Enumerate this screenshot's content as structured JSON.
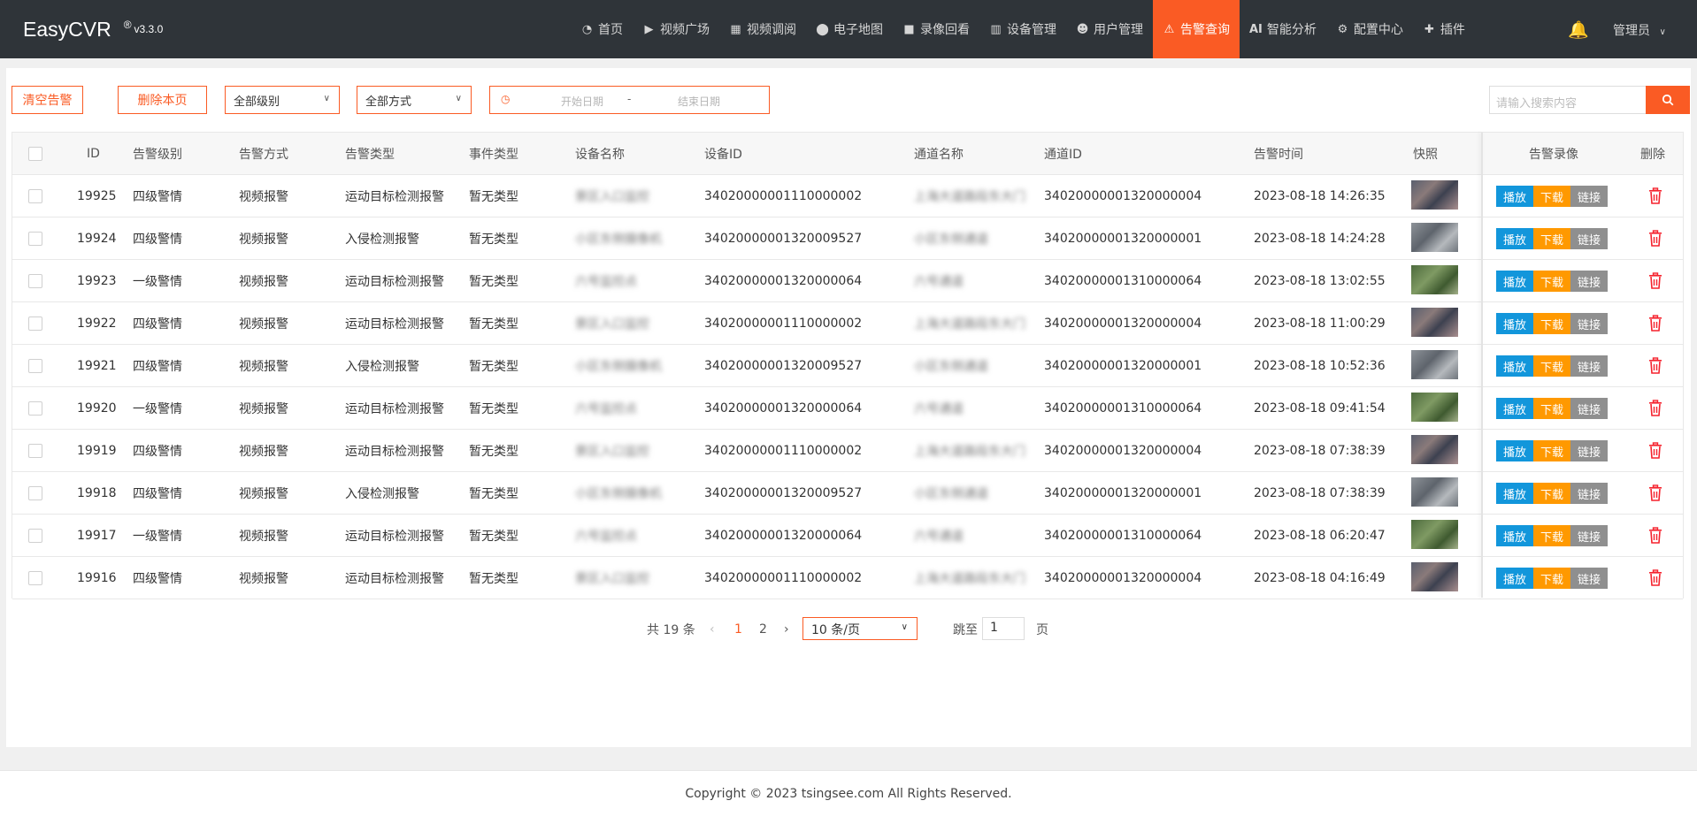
{
  "app": {
    "name": "EasyCVR",
    "registered": "®",
    "version": "v3.3.0"
  },
  "nav": [
    {
      "label": "首页",
      "icon": "dashboard-icon",
      "glyph": "◔",
      "active": false
    },
    {
      "label": "视频广场",
      "icon": "play-circle-icon",
      "glyph": "▶",
      "active": false
    },
    {
      "label": "视频调阅",
      "icon": "grid-layout-icon",
      "glyph": "▦",
      "active": false
    },
    {
      "label": "电子地图",
      "icon": "map-pin-icon",
      "glyph": "⬤",
      "active": false
    },
    {
      "label": "录像回看",
      "icon": "video-camera-icon",
      "glyph": "■",
      "active": false
    },
    {
      "label": "设备管理",
      "icon": "device-icon",
      "glyph": "▥",
      "active": false
    },
    {
      "label": "用户管理",
      "icon": "user-icon",
      "glyph": "☻",
      "active": false
    },
    {
      "label": "告警查询",
      "icon": "alarm-siren-icon",
      "glyph": "⚠",
      "active": true
    },
    {
      "label": "智能分析",
      "icon": "ai-icon",
      "glyph": "AI",
      "active": false
    },
    {
      "label": "配置中心",
      "icon": "gear-icon",
      "glyph": "⚙",
      "active": false
    },
    {
      "label": "插件",
      "icon": "puzzle-icon",
      "glyph": "✚",
      "active": false
    }
  ],
  "user": {
    "label": "管理员"
  },
  "toolbar": {
    "clear_label": "清空告警",
    "delete_page_label": "删除本页",
    "level_select": "全部级别",
    "method_select": "全部方式",
    "date_start_placeholder": "开始日期",
    "date_sep": "-",
    "date_end_placeholder": "结束日期",
    "search_placeholder": "请输入搜索内容"
  },
  "table": {
    "headers": {
      "id": "ID",
      "level": "告警级别",
      "method": "告警方式",
      "type": "告警类型",
      "event": "事件类型",
      "device_name": "设备名称",
      "device_id": "设备ID",
      "channel_name": "通道名称",
      "channel_id": "通道ID",
      "time": "告警时间",
      "snapshot": "快照",
      "recording": "告警录像",
      "delete": "删除"
    },
    "action_labels": {
      "play": "播放",
      "download": "下载",
      "link": "链接"
    },
    "rows": [
      {
        "id": "19925",
        "level": "四级警情",
        "method": "视频报警",
        "type": "运动目标检测报警",
        "event": "暂无类型",
        "device_name": "景区入口监控",
        "device_id": "34020000001110000002",
        "channel_name": "上海大道路段东大门",
        "channel_id": "34020000001320000004",
        "time": "2023-08-18 14:26:35",
        "snap": "dark"
      },
      {
        "id": "19924",
        "level": "四级警情",
        "method": "视频报警",
        "type": "入侵检测报警",
        "event": "暂无类型",
        "device_name": "小区东侧摄像机",
        "device_id": "34020000001320009527",
        "channel_name": "小区东侧通道",
        "channel_id": "34020000001320000001",
        "time": "2023-08-18 14:24:28",
        "snap": "gray"
      },
      {
        "id": "19923",
        "level": "一级警情",
        "method": "视频报警",
        "type": "运动目标检测报警",
        "event": "暂无类型",
        "device_name": "六号监控点",
        "device_id": "34020000001320000064",
        "channel_name": "六号通道",
        "channel_id": "34020000001310000064",
        "time": "2023-08-18 13:02:55",
        "snap": "green"
      },
      {
        "id": "19922",
        "level": "四级警情",
        "method": "视频报警",
        "type": "运动目标检测报警",
        "event": "暂无类型",
        "device_name": "景区入口监控",
        "device_id": "34020000001110000002",
        "channel_name": "上海大道路段东大门",
        "channel_id": "34020000001320000004",
        "time": "2023-08-18 11:00:29",
        "snap": "dark"
      },
      {
        "id": "19921",
        "level": "四级警情",
        "method": "视频报警",
        "type": "入侵检测报警",
        "event": "暂无类型",
        "device_name": "小区东侧摄像机",
        "device_id": "34020000001320009527",
        "channel_name": "小区东侧通道",
        "channel_id": "34020000001320000001",
        "time": "2023-08-18 10:52:36",
        "snap": "gray"
      },
      {
        "id": "19920",
        "level": "一级警情",
        "method": "视频报警",
        "type": "运动目标检测报警",
        "event": "暂无类型",
        "device_name": "六号监控点",
        "device_id": "34020000001320000064",
        "channel_name": "六号通道",
        "channel_id": "34020000001310000064",
        "time": "2023-08-18 09:41:54",
        "snap": "green"
      },
      {
        "id": "19919",
        "level": "四级警情",
        "method": "视频报警",
        "type": "运动目标检测报警",
        "event": "暂无类型",
        "device_name": "景区入口监控",
        "device_id": "34020000001110000002",
        "channel_name": "上海大道路段东大门",
        "channel_id": "34020000001320000004",
        "time": "2023-08-18 07:38:39",
        "snap": "dark"
      },
      {
        "id": "19918",
        "level": "四级警情",
        "method": "视频报警",
        "type": "入侵检测报警",
        "event": "暂无类型",
        "device_name": "小区东侧摄像机",
        "device_id": "34020000001320009527",
        "channel_name": "小区东侧通道",
        "channel_id": "34020000001320000001",
        "time": "2023-08-18 07:38:39",
        "snap": "gray"
      },
      {
        "id": "19917",
        "level": "一级警情",
        "method": "视频报警",
        "type": "运动目标检测报警",
        "event": "暂无类型",
        "device_name": "六号监控点",
        "device_id": "34020000001320000064",
        "channel_name": "六号通道",
        "channel_id": "34020000001310000064",
        "time": "2023-08-18 06:20:47",
        "snap": "green"
      },
      {
        "id": "19916",
        "level": "四级警情",
        "method": "视频报警",
        "type": "运动目标检测报警",
        "event": "暂无类型",
        "device_name": "景区入口监控",
        "device_id": "34020000001110000002",
        "channel_name": "上海大道路段东大门",
        "channel_id": "34020000001320000004",
        "time": "2023-08-18 04:16:49",
        "snap": "dark"
      }
    ]
  },
  "pagination": {
    "total_label": "共 19 条",
    "pages": [
      "1",
      "2"
    ],
    "current": "1",
    "page_size": "10 条/页",
    "jump_label": "跳至",
    "jump_value": "1",
    "page_suffix": "页"
  },
  "footer": {
    "copyright": "Copyright © 2023 tsingsee.com All Rights Reserved."
  },
  "colors": {
    "accent": "#fa5b24",
    "navbar": "#2f3439",
    "play": "#1296db",
    "download": "#ff9900",
    "link": "#8f8f8f",
    "delete": "#f5222d"
  }
}
